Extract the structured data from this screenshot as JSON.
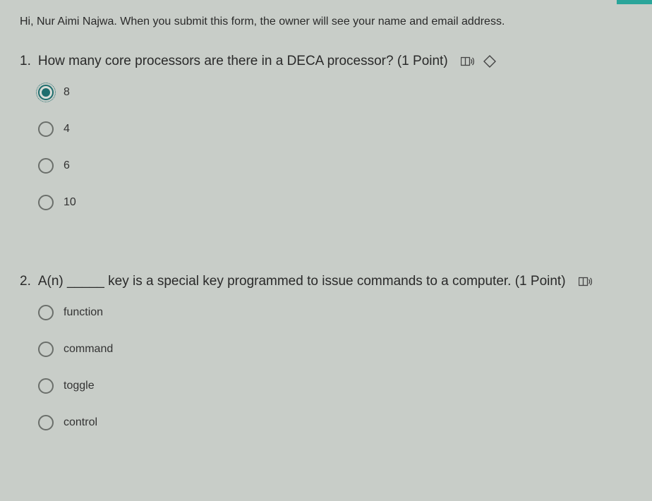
{
  "notice": "Hi, Nur Aimi Najwa. When you submit this form, the owner will see your name and email address.",
  "questions": [
    {
      "number": "1.",
      "text": "How many core processors are there in a DECA processor? (1 Point)",
      "has_immersive_icon": true,
      "has_tag_icon": true,
      "selected_index": 0,
      "options": [
        "8",
        "4",
        "6",
        "10"
      ]
    },
    {
      "number": "2.",
      "text": "A(n) _____ key is a special key programmed to issue commands to a computer. (1 Point)",
      "has_immersive_icon": true,
      "has_tag_icon": false,
      "selected_index": -1,
      "options": [
        "function",
        "command",
        "toggle",
        "control"
      ]
    }
  ]
}
